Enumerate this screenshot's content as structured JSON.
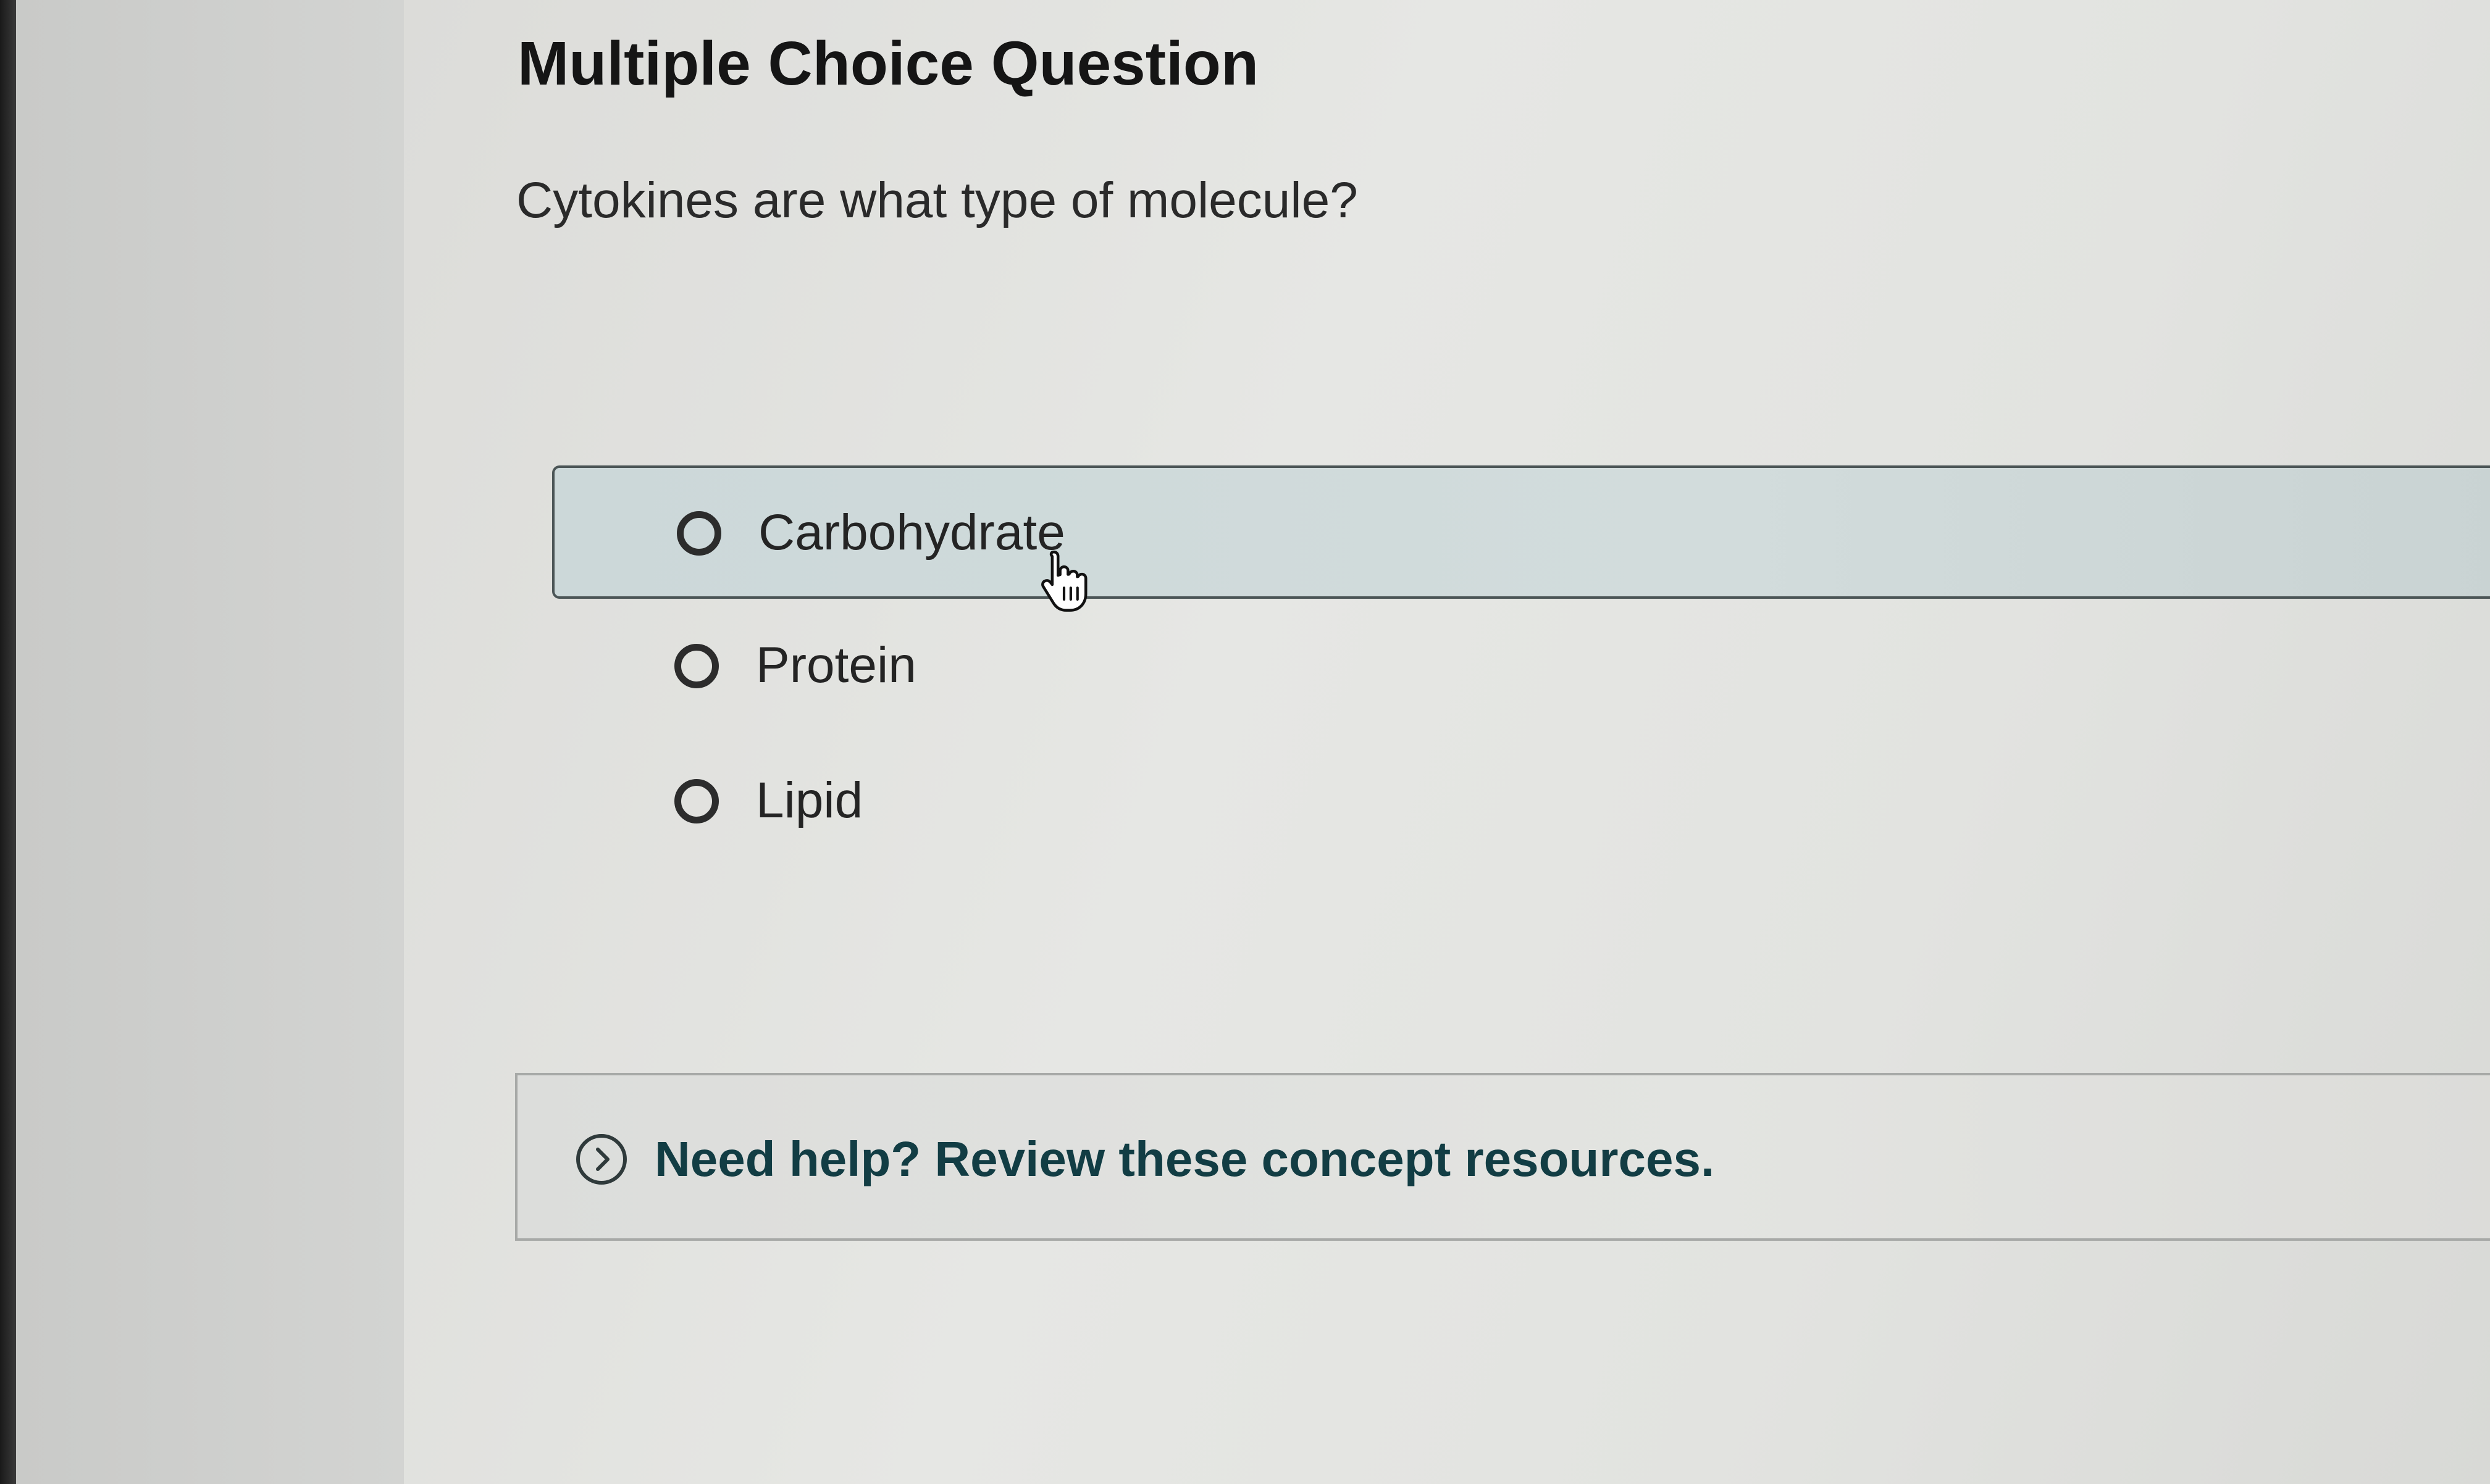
{
  "question_card": {
    "type_label": "Multiple Choice Question",
    "prompt": "Cytokines are what type of molecule?"
  },
  "options": [
    {
      "label": "Carbohydrate",
      "state": "hovered"
    },
    {
      "label": "Protein",
      "state": "default"
    },
    {
      "label": "Lipid",
      "state": "default"
    }
  ],
  "help": {
    "text": "Need help? Review these concept resources.",
    "icon": "chevron-right-circle-icon"
  },
  "cursor": {
    "icon": "hand-pointer-icon"
  },
  "colors": {
    "hover_background": "#ccd8d9",
    "hover_border": "#4b5556",
    "help_text": "#123d44",
    "radio_ring": "#2c2c2c"
  }
}
